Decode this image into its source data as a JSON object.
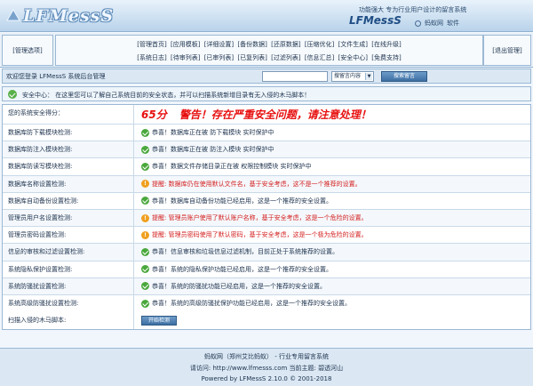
{
  "header": {
    "logo": "LFMessS",
    "slogan": "功能强大 专为行业用户设计的留言系统",
    "brand": "LFMessS",
    "top_links": [
      "蚂蚁网",
      "软件"
    ]
  },
  "nav": {
    "left_label": "[管理选项]",
    "right_label": "[退出管理]",
    "row1": [
      "[管理首页]",
      "[应用模板]",
      "[详细设置]",
      "[备份数据]",
      "[还原数据]",
      "[压缩优化]",
      "[文件生成]",
      "[在线升级]"
    ],
    "row2": [
      "[系统日志]",
      "[待审列表]",
      "[已审列表]",
      "[已复列表]",
      "[过滤列表]",
      "[信息汇总]",
      "[安全中心]",
      "[免费支持]"
    ]
  },
  "welcome": {
    "text": "欢迎您登录 LFMessS 系统后台管理",
    "search_value": "",
    "select_value": "搜留言内容",
    "search_button": "搜索留言"
  },
  "safety": {
    "text": "安全中心： 在这里您可以了解自己系统目前的安全状态，并可以扫描系统新增目录有无入侵的木马脚本！"
  },
  "checks": {
    "score_label": "您的系统安全得分：",
    "score": "65分",
    "score_msg": "警告！存在严重安全问题，请注意处理！",
    "rows": [
      {
        "label": "数据库防下载模块检测:",
        "status": "ok",
        "text": "恭喜！数据库正在被 防下载模块 实时保护中"
      },
      {
        "label": "数据库防注入模块检测:",
        "status": "ok",
        "text": "恭喜！数据库正在被 防注入模块 实时保护中"
      },
      {
        "label": "数据库防读写模块检测:",
        "status": "ok",
        "text": "恭喜！数据文件存储目录正在被 权限控制模块 实时保护中"
      },
      {
        "label": "数据库名称设置检测:",
        "status": "warn",
        "text": "提醒: 数据库仍在使用默认文件名，基于安全考虑，这不是一个推荐的设置。"
      },
      {
        "label": "数据库自动备份设置检测:",
        "status": "ok",
        "text": "恭喜！数据库自动备份功能已经启用，这是一个推荐的安全设置。"
      },
      {
        "label": "管理员用户名设置检测:",
        "status": "warn",
        "text": "提醒: 管理员账户使用了默认账户名称，基于安全考虑，这是一个危险的设置。"
      },
      {
        "label": "管理员密码设置检测:",
        "status": "warn",
        "text": "提醒: 管理员密码使用了默认密码，基于安全考虑，这是一个极为危险的设置。"
      },
      {
        "label": "信息的审核和过滤设置检测:",
        "status": "ok",
        "text": "恭喜！信息审核和垃圾信息过滤机制，目前正处于系统推荐的设置。"
      },
      {
        "label": "系统隐私保护设置检测:",
        "status": "ok",
        "text": "恭喜！系统的隐私保护功能已经启用，这是一个推荐的安全设置。"
      },
      {
        "label": "系统防骚扰设置检测:",
        "status": "ok",
        "text": "恭喜！系统的防骚扰功能已经启用，这是一个推荐的安全设置。"
      },
      {
        "label": "系统高级防骚扰设置检测:",
        "status": "ok",
        "text": "恭喜！系统的高级防骚扰保护功能已经启用，这是一个推荐的安全设置。"
      }
    ],
    "scan_label": "扫描入侵的木马脚本:",
    "scan_button": "开始检测"
  },
  "footer": {
    "line1": "蚂蚁网（郑州艾比蚂蚁） - 行业专用留言系统",
    "line2": "请访问: http://www.lfmesss.com   当前主题: 碧透河山",
    "line3": "Powered by LFMessS 2.10.0 © 2001-2018"
  }
}
